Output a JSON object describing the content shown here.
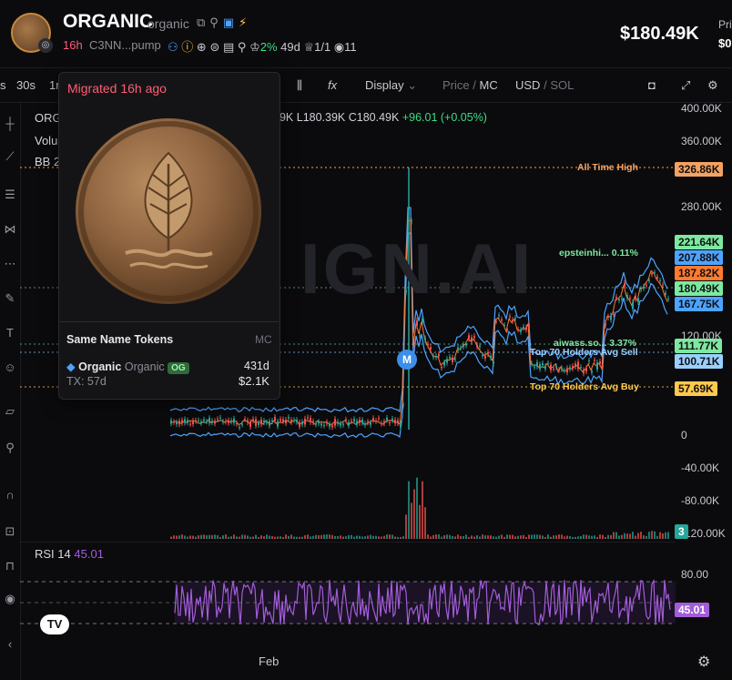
{
  "header": {
    "ticker": "ORGANIC",
    "name": "organic",
    "icons": [
      "copy-icon",
      "share-icon",
      "twitter-icon",
      "bolt-icon"
    ],
    "age": "16h",
    "address": "C3NN...pump",
    "holders_pct": "2%",
    "holders_age": "49d",
    "crown_value": "1/1",
    "views": "11",
    "price": "$180.49K",
    "price_label": "Pri",
    "price_sub": "$0"
  },
  "toolbar": {
    "intervals": [
      "s",
      "30s",
      "1m"
    ],
    "display_label": "Display",
    "price_label": "Price",
    "mc_label": "MC",
    "usd_label": "USD",
    "sol_label": "SOL",
    "sep": "/",
    "fx_label": "fx"
  },
  "chart": {
    "legend_title": "ORG",
    "legend_volume": "Volu",
    "legend_bb": "BB 2",
    "ohlc_h": "49K",
    "ohlc_l_label": "L",
    "ohlc_l": "180.39K",
    "ohlc_c_label": "C",
    "ohlc_c": "180.49K",
    "ohlc_change": "+96.01 (+0.05%)",
    "watermark": "IGN.AI",
    "y_labels": [
      "400.00K",
      "360.00K",
      "280.00K",
      "120.00K",
      "0",
      "-40.00K",
      "-80.00K",
      "-120.00K"
    ],
    "tags": [
      {
        "text": "326.86K",
        "color": "#f4a261"
      },
      {
        "text": "221.64K",
        "color": "#7ee8a1"
      },
      {
        "text": "207.88K",
        "color": "#4da3ff"
      },
      {
        "text": "187.82K",
        "color": "#ff7a2f"
      },
      {
        "text": "180.49K",
        "color": "#7ee8a1"
      },
      {
        "text": "167.75K",
        "color": "#4da3ff"
      },
      {
        "text": "111.77K",
        "color": "#7ee8a1"
      },
      {
        "text": "100.71K",
        "color": "#9ad0ff"
      },
      {
        "text": "57.69K",
        "color": "#ffc94d"
      },
      {
        "text": "3",
        "color": "#26a69a"
      }
    ],
    "line_labels": {
      "ath": "All Time High",
      "eps": "epsteinhi... 0.11%",
      "aiwass": "aiwass.so... 3.37%",
      "top_sell": "Top 70 Holders Avg Sell",
      "top_buy": "Top 70 Holders Avg Buy"
    },
    "m_badge": "M"
  },
  "rsi": {
    "label": "RSI",
    "period": "14",
    "value": "45.01",
    "level": "80.00",
    "tag": "45.01"
  },
  "xaxis": {
    "feb": "Feb"
  },
  "popup": {
    "migrated": "Migrated 16h ago",
    "same_name": "Same Name Tokens",
    "mc": "MC",
    "token_name": "Organic",
    "token_sub": "Organic",
    "badge": "OG",
    "age": "431d",
    "tx": "TX: 57d",
    "mc_value": "$2.1K"
  },
  "colors": {
    "accent_red": "#ff5d73",
    "accent_green": "#3ddc84",
    "rsi": "#a35dd8",
    "bb_blue": "#4da3ff"
  }
}
